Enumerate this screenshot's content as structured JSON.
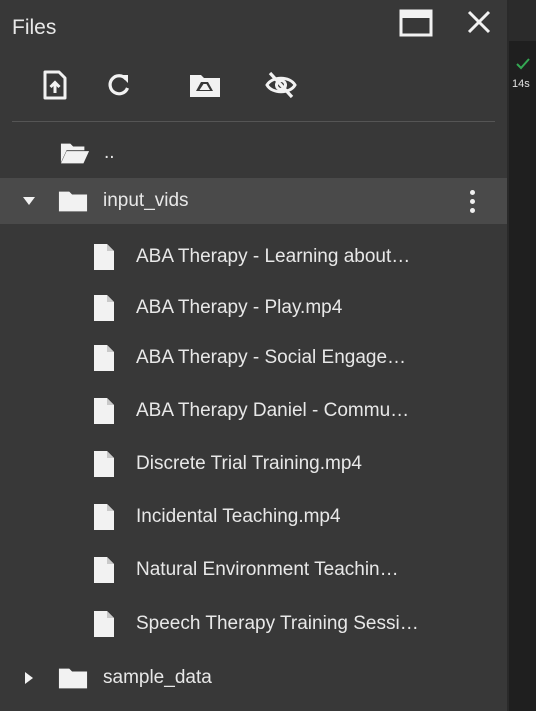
{
  "panel": {
    "title": "Files"
  },
  "toolbar": {
    "buttons": [
      {
        "icon": "upload-file-icon"
      },
      {
        "icon": "refresh-icon"
      },
      {
        "icon": "mount-drive-icon"
      },
      {
        "icon": "hide-hidden-files-icon"
      }
    ]
  },
  "tree": {
    "parent": {
      "label": ".."
    },
    "folder_open": {
      "label": "input_vids"
    },
    "files": [
      {
        "label": "ABA Therapy - Learning about…"
      },
      {
        "label": "ABA Therapy - Play.mp4"
      },
      {
        "label": "ABA Therapy - Social Engage…"
      },
      {
        "label": "ABA Therapy Daniel - Commu…"
      },
      {
        "label": "Discrete Trial Training.mp4"
      },
      {
        "label": "Incidental Teaching.mp4"
      },
      {
        "label": "Natural Environment Teachin…"
      },
      {
        "label": "Speech Therapy Training Sessi…"
      }
    ],
    "folder_closed": {
      "label": "sample_data"
    }
  },
  "run_status": {
    "time": "14s",
    "color": "#34a853"
  },
  "colors": {
    "panel_bg": "#383838",
    "selected_bg": "#4a4a4a",
    "icon": "#f2f2f2"
  }
}
